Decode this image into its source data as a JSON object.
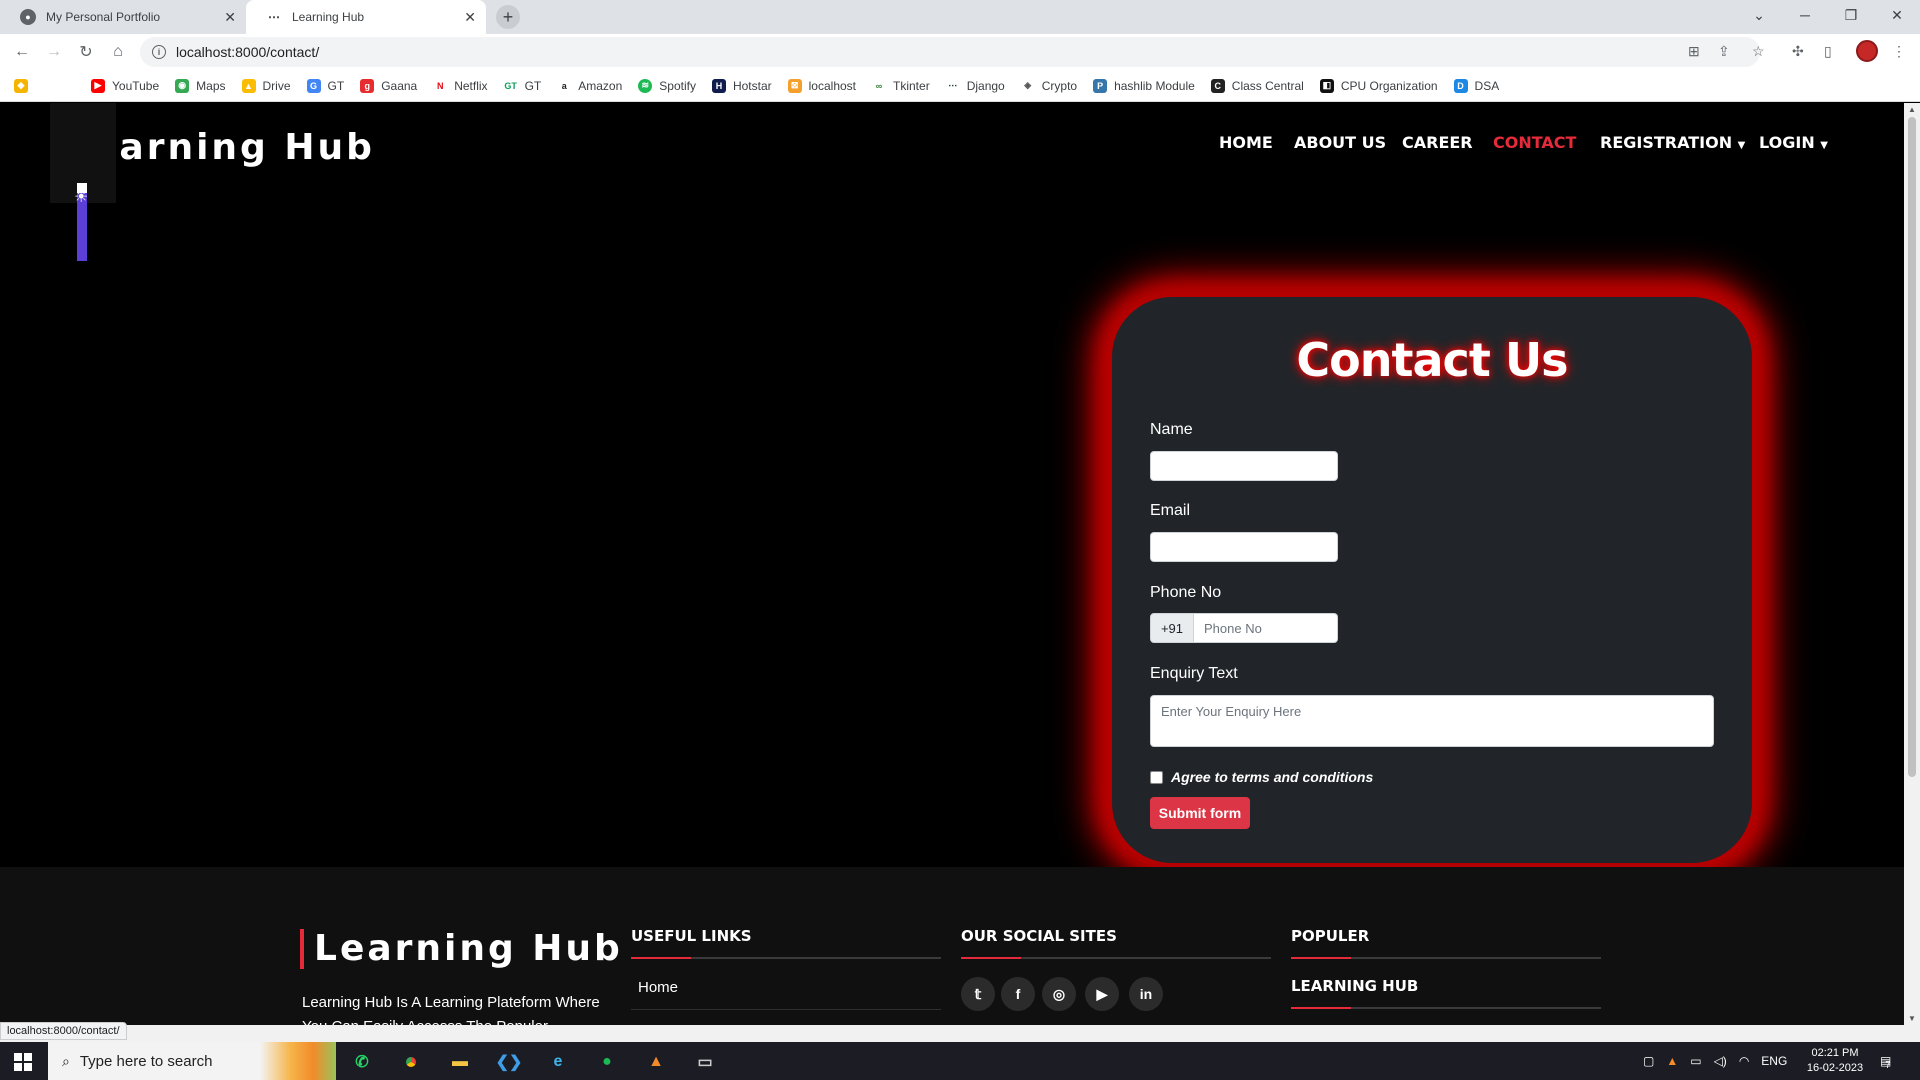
{
  "browser": {
    "tabs": [
      {
        "title": "My Personal Portfolio",
        "active": false
      },
      {
        "title": "Learning Hub",
        "active": true
      }
    ],
    "new_tab_icon": "plus-icon",
    "url": "localhost:8000/contact/",
    "status_url": "localhost:8000/contact/",
    "bookmarks": [
      {
        "label": "YouTube",
        "color": "#ff0000",
        "icon": "youtube-icon"
      },
      {
        "label": "Maps",
        "color": "#34a853",
        "icon": "maps-icon"
      },
      {
        "label": "Drive",
        "color": "#fbbc04",
        "icon": "drive-icon"
      },
      {
        "label": "GT",
        "color": "#4285f4",
        "icon": "translate-icon"
      },
      {
        "label": "Gaana",
        "color": "#e72c30",
        "icon": "gaana-icon"
      },
      {
        "label": "Netflix",
        "color": "#e50914",
        "icon": "netflix-icon"
      },
      {
        "label": "GT",
        "color": "#0f9d58",
        "icon": "gt-icon"
      },
      {
        "label": "Amazon",
        "color": "#222222",
        "icon": "amazon-icon"
      },
      {
        "label": "Spotify",
        "color": "#1db954",
        "icon": "spotify-icon"
      },
      {
        "label": "Hotstar",
        "color": "#0f1c4d",
        "icon": "hotstar-icon"
      },
      {
        "label": "localhost",
        "color": "#f4a02c",
        "icon": "localhost-icon"
      },
      {
        "label": "Tkinter",
        "color": "#2e7d32",
        "icon": "tkinter-icon"
      },
      {
        "label": "Django",
        "color": "#092e20",
        "icon": "django-icon"
      },
      {
        "label": "Crypto",
        "color": "#555555",
        "icon": "crypto-icon"
      },
      {
        "label": "hashlib Module",
        "color": "#3776ab",
        "icon": "python-icon"
      },
      {
        "label": "Class Central",
        "color": "#222222",
        "icon": "class-central-icon"
      },
      {
        "label": "CPU Organization",
        "color": "#111111",
        "icon": "cpu-icon"
      },
      {
        "label": "DSA",
        "color": "#1e88e5",
        "icon": "dsa-icon"
      }
    ]
  },
  "site": {
    "logo": "Learning Hub",
    "logo_visible": "earning Hub",
    "nav": [
      {
        "label": "HOME",
        "active": false
      },
      {
        "label": "ABOUT US",
        "active": false
      },
      {
        "label": "CAREER",
        "active": false
      },
      {
        "label": "CONTACT",
        "active": true
      },
      {
        "label": "REGISTRATION",
        "active": false,
        "dropdown": true
      },
      {
        "label": "LOGIN",
        "active": false,
        "dropdown": true
      }
    ],
    "accent": "#e52b3a"
  },
  "contact_form": {
    "title": "Contact Us",
    "name_label": "Name",
    "name_value": "",
    "email_label": "Email",
    "email_value": "",
    "phone_label": "Phone No",
    "phone_prefix": "+91",
    "phone_placeholder": "Phone No",
    "enquiry_label": "Enquiry Text",
    "enquiry_placeholder": "Enter Your Enquiry Here",
    "agree_label": "Agree to terms and conditions",
    "agree_checked": false,
    "submit_label": "Submit form"
  },
  "footer": {
    "logo": "Learning Hub",
    "description": "Learning Hub Is A Learning Plateform Where You Can Easily Accesss The Populer",
    "useful_links_heading": "USEFUL LINKS",
    "useful_links": [
      "Home"
    ],
    "social_heading": "OUR SOCIAL SITES",
    "social_icons": [
      "twitter-icon",
      "facebook-icon",
      "instagram-icon",
      "youtube-icon",
      "linkedin-icon"
    ],
    "populer_heading": "POPULER",
    "populer_subheading": "LEARNING HUB"
  },
  "taskbar": {
    "search_placeholder": "Type here to search",
    "language": "ENG",
    "time": "02:21 PM",
    "date": "16-02-2023",
    "notification_count": "7"
  }
}
